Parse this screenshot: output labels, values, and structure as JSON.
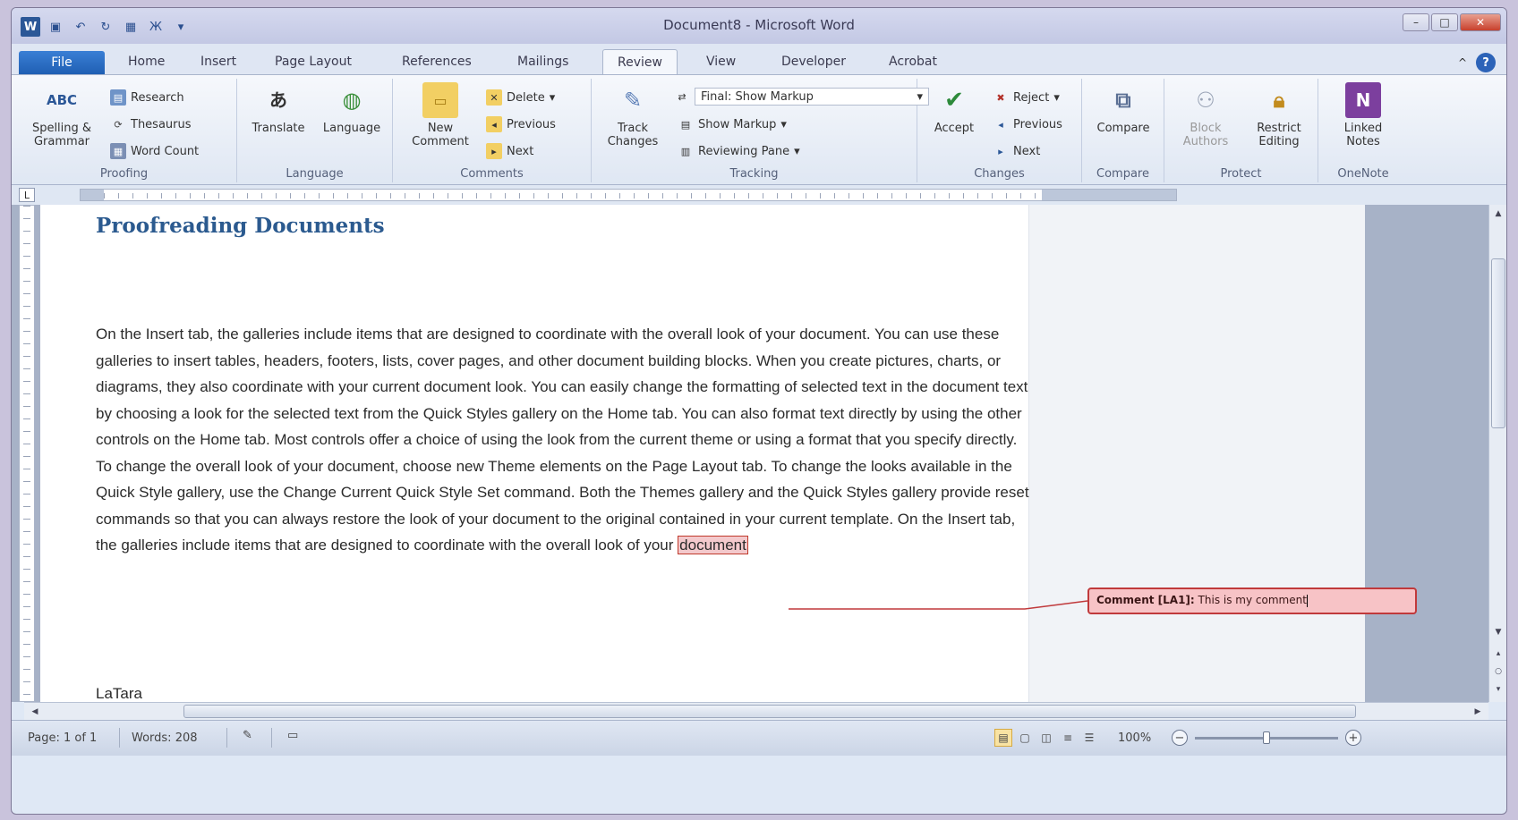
{
  "title_bar": {
    "app_icon": "W",
    "window_title": "Document8 - Microsoft Word",
    "qat": [
      {
        "name": "save-icon",
        "glyph": "▣"
      },
      {
        "name": "undo-icon",
        "glyph": "↶"
      },
      {
        "name": "redo-icon",
        "glyph": "↻"
      },
      {
        "name": "table-icon",
        "glyph": "▦"
      },
      {
        "name": "format-icon",
        "glyph": "Ж"
      },
      {
        "name": "qat-customize-icon",
        "glyph": "▾"
      }
    ],
    "controls": {
      "minimize": "–",
      "maximize": "□",
      "close": "✕"
    }
  },
  "tabs": {
    "file": "File",
    "items": [
      "Home",
      "Insert",
      "Page Layout",
      "References",
      "Mailings",
      "Review",
      "View",
      "Developer",
      "Acrobat"
    ],
    "active": "Review",
    "help": "?",
    "minimize_ribbon": "^"
  },
  "ribbon": {
    "proofing": {
      "label": "Proofing",
      "spelling": "Spelling & Grammar",
      "spelling_icon": "ABC",
      "research": "Research",
      "thesaurus": "Thesaurus",
      "word_count": "Word Count"
    },
    "language": {
      "label": "Language",
      "translate": "Translate",
      "language": "Language"
    },
    "comments": {
      "label": "Comments",
      "new_comment": "New Comment",
      "delete": "Delete",
      "previous": "Previous",
      "next": "Next"
    },
    "tracking": {
      "label": "Tracking",
      "track_changes": "Track Changes",
      "display_mode": "Final: Show Markup",
      "show_markup": "Show Markup",
      "reviewing_pane": "Reviewing Pane"
    },
    "changes": {
      "label": "Changes",
      "accept": "Accept",
      "reject": "Reject",
      "previous": "Previous",
      "next": "Next"
    },
    "compare": {
      "label": "Compare",
      "compare": "Compare"
    },
    "protect": {
      "label": "Protect",
      "block_authors": "Block Authors",
      "restrict_editing": "Restrict Editing"
    },
    "onenote": {
      "label": "OneNote",
      "linked_notes": "Linked Notes",
      "linked_notes_icon": "N"
    }
  },
  "document": {
    "title": "Proofreading Documents",
    "body_text": "On the Insert tab, the galleries include items that are designed to coordinate with the overall look of your document. You can use these galleries to insert tables, headers, footers, lists, cover pages, and other document building blocks. When you create pictures, charts, or diagrams, they also coordinate with your current document look. You can easily change the formatting of selected text in the document text by choosing a look for the selected text from the Quick Styles gallery on the Home tab. You can also format text directly by using the other controls on the Home tab. Most controls offer a choice of using the look from the current theme or using a format that you specify directly. To change the overall look of your document, choose new Theme elements on the Page Layout tab. To change the looks available in the Quick Style gallery, use the Change Current Quick Style Set command. Both the Themes gallery and the Quick Styles gallery provide reset commands so that you can always restore the look of your document to the original contained in your current template. On the Insert tab, the galleries include items that are designed to coordinate with the overall look of your",
    "highlighted_word": "document",
    "author_line": "LaTara"
  },
  "comment": {
    "label": "Comment [LA1]:",
    "text": "This is my comment"
  },
  "status_bar": {
    "page": "Page: 1 of 1",
    "words": "Words: 208",
    "zoom": "100%",
    "zoom_level_fraction": 0.5,
    "zoom_out": "−",
    "zoom_in": "+"
  },
  "colors": {
    "accent": "#2b5797",
    "comment_fill": "#f7c3c6",
    "comment_border": "#c0393b",
    "heading": "#2b5a8f"
  }
}
